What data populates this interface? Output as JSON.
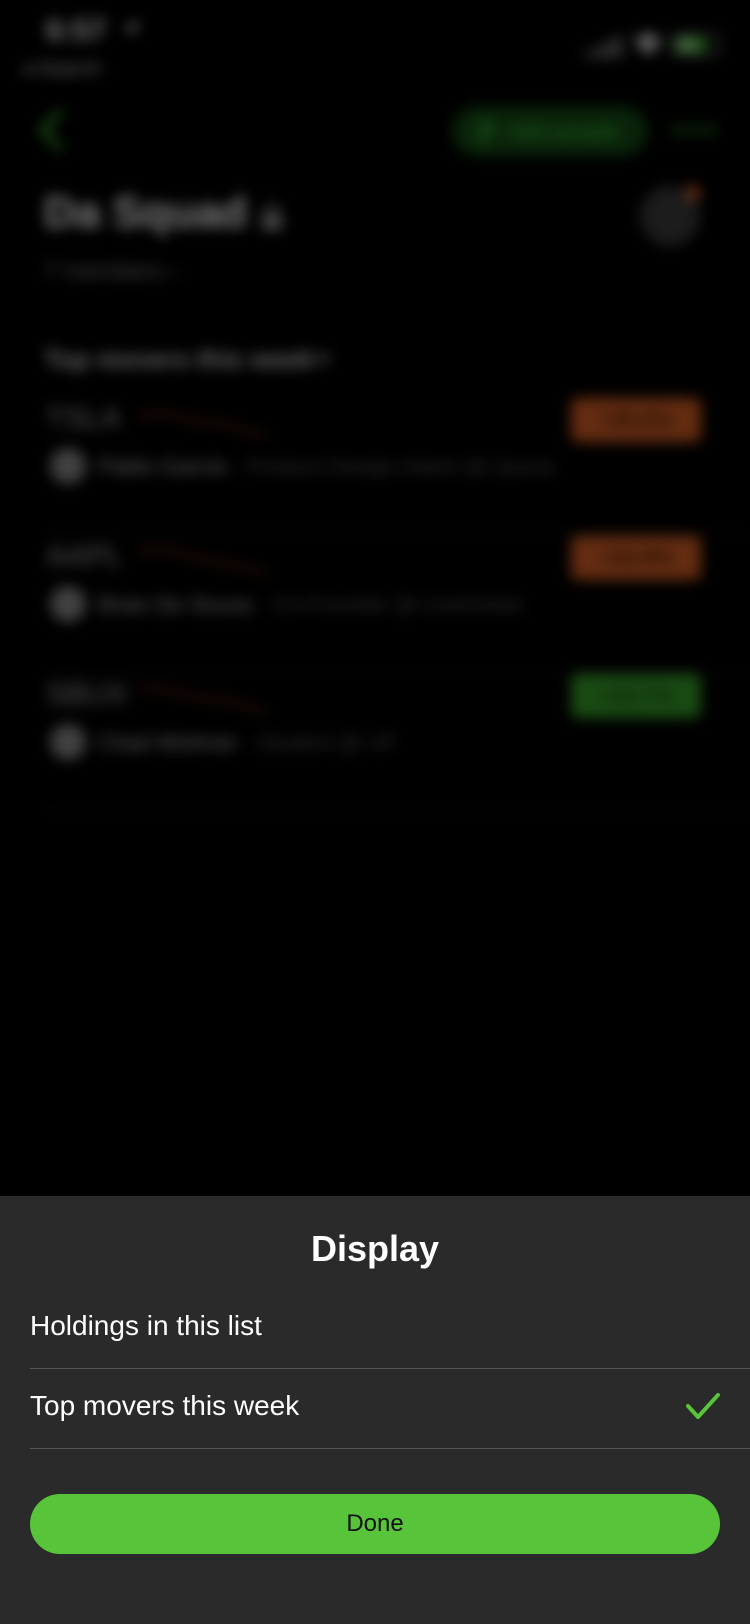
{
  "colors": {
    "accent": "#58c43a",
    "negative": "#e0622d",
    "sheet": "#2a2a2a"
  },
  "status_bar": {
    "time": "6:57",
    "back_label": "◂ Search",
    "battery": "36"
  },
  "header": {
    "add_people_label": "Add people",
    "more_icon": "ellipsis-icon"
  },
  "group": {
    "title": "Da Squad",
    "members": "7 members ›"
  },
  "section": {
    "title": "Top movers this week"
  },
  "movers": [
    {
      "ticker": "TSLA",
      "change": "+45.6%",
      "direction": "down",
      "name": "Pablo García",
      "role": "Product Design Intern @ Quora"
    },
    {
      "ticker": "AAPL",
      "change": "+34.9%",
      "direction": "down",
      "name": "Brian De Souza",
      "role": "Co-Founder @ LiveGreen"
    },
    {
      "ticker": "SBUX",
      "change": "+23.7%",
      "direction": "up",
      "name": "Chad Wishner",
      "role": "Student @ UF"
    }
  ],
  "sheet": {
    "title": "Display",
    "options": [
      {
        "label": "Holdings in this list",
        "selected": false
      },
      {
        "label": "Top movers this week",
        "selected": true
      }
    ],
    "done_label": "Done"
  }
}
